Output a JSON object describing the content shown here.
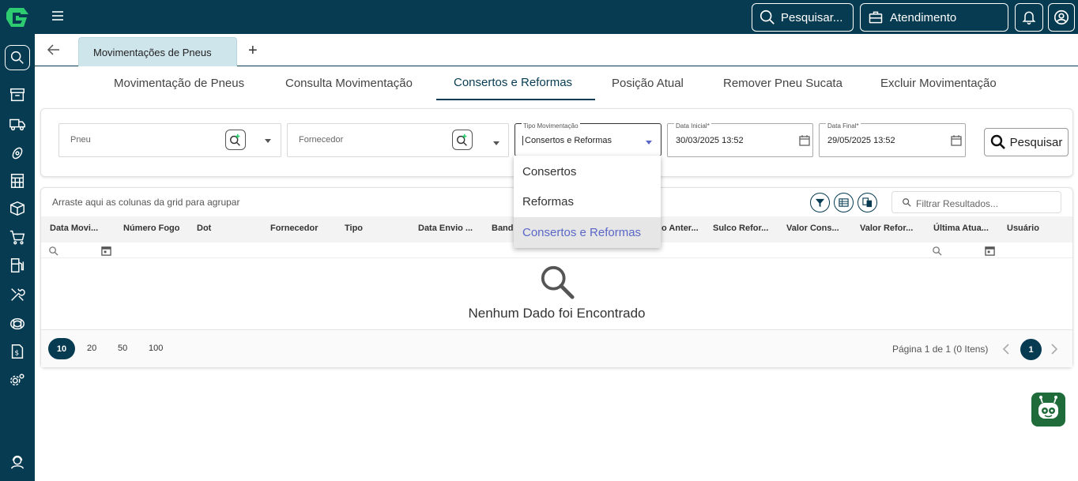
{
  "topbar": {
    "search_label": "Pesquisar...",
    "service_label": "Atendimento"
  },
  "tabs": {
    "page_tab": "Movimentações de Pneus",
    "add_symbol": "+"
  },
  "subtabs": [
    {
      "label": "Movimentação de Pneus"
    },
    {
      "label": "Consulta Movimentação"
    },
    {
      "label": "Consertos e Reformas"
    },
    {
      "label": "Posição Atual"
    },
    {
      "label": "Remover Pneu Sucata"
    },
    {
      "label": "Excluir Movimentação"
    }
  ],
  "filters": {
    "pneu_placeholder": "Pneu",
    "fornecedor_placeholder": "Fornecedor",
    "tipo_label": "Tipo Movimentação",
    "tipo_value": "Consertos e Reformas",
    "data_inicial_label": "Data Inicial*",
    "data_inicial_value": "30/03/2025 13:52",
    "data_final_label": "Data Final*",
    "data_final_value": "29/05/2025 13:52",
    "search_button": "Pesquisar"
  },
  "dropdown": {
    "options": [
      "Consertos",
      "Reformas",
      "Consertos e Reformas"
    ],
    "selected": "Consertos e Reformas"
  },
  "grid": {
    "group_hint": "Arraste aqui as colunas da grid para agrupar",
    "filter_placeholder": "Filtrar Resultados...",
    "columns": [
      "Data Movi...",
      "Número Fogo",
      "Dot",
      "Fornecedor",
      "Tipo",
      "Data Envio ...",
      "Band",
      "o Anter...",
      "Sulco Refor...",
      "Valor Cons...",
      "Valor Refor...",
      "Última Atua...",
      "Usuário"
    ],
    "empty_message": "Nenhum Dado foi Encontrado"
  },
  "pager": {
    "sizes": [
      "10",
      "20",
      "50",
      "100"
    ],
    "active_size": "10",
    "info": "Página 1 de 1 (0 Itens)",
    "current_page": "1"
  },
  "colors": {
    "brand": "#063b52",
    "accent_green": "#2ecc71",
    "selected_option": "#5a67c7"
  }
}
